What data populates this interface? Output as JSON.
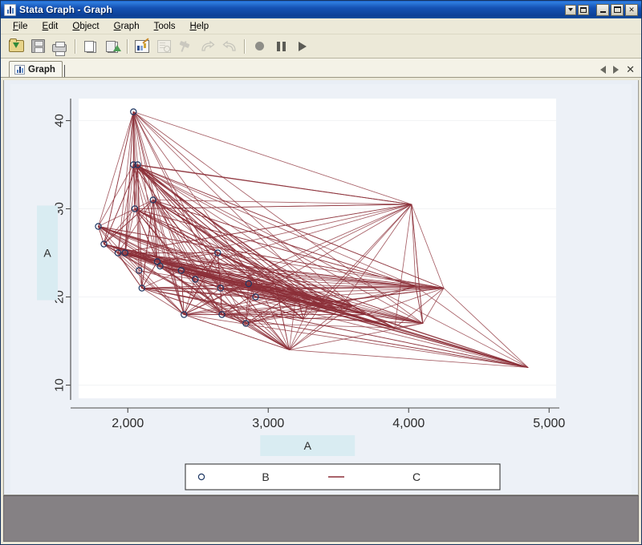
{
  "window": {
    "title": "Stata Graph - Graph",
    "title_icon": "bar-chart-icon",
    "buttons": {
      "mdi_restore_menu": "▾",
      "mdi_restore": "Restore",
      "minimize": "Minimize",
      "maximize": "Maximize",
      "close": "Close"
    }
  },
  "menubar": {
    "items": [
      {
        "label": "File",
        "accel": "F"
      },
      {
        "label": "Edit",
        "accel": "E"
      },
      {
        "label": "Object",
        "accel": "O"
      },
      {
        "label": "Graph",
        "accel": "G"
      },
      {
        "label": "Tools",
        "accel": "T"
      },
      {
        "label": "Help",
        "accel": "H"
      }
    ]
  },
  "toolbar": {
    "items": [
      {
        "name": "open-icon",
        "label": "Open",
        "enabled": true
      },
      {
        "name": "save-icon",
        "label": "Save",
        "enabled": true
      },
      {
        "name": "print-icon",
        "label": "Print",
        "enabled": true
      },
      {
        "name": "copy-icon",
        "label": "Copy",
        "enabled": true
      },
      {
        "name": "paste-icon",
        "label": "Paste",
        "enabled": true
      },
      {
        "name": "graph-editor-icon",
        "label": "Start Graph Editor",
        "enabled": true
      },
      {
        "name": "preview-icon",
        "label": "Preview",
        "enabled": false
      },
      {
        "name": "pin-icon",
        "label": "Pin",
        "enabled": false
      },
      {
        "name": "redo-icon",
        "label": "Redo",
        "enabled": false
      },
      {
        "name": "undo-icon",
        "label": "Undo",
        "enabled": false
      },
      {
        "name": "record-icon",
        "label": "Record",
        "enabled": true
      },
      {
        "name": "pause-icon",
        "label": "Pause",
        "enabled": true
      },
      {
        "name": "play-icon",
        "label": "Play",
        "enabled": true
      }
    ]
  },
  "tabstrip": {
    "tabs": [
      {
        "label": "Graph",
        "icon": "bar-chart-icon",
        "active": true
      }
    ],
    "nav": {
      "prev": "◀",
      "next": "▶",
      "close": "✕"
    }
  },
  "statusbar": {
    "text": ""
  },
  "chart_data": {
    "type": "scatter",
    "title": "",
    "xlabel": "A",
    "ylabel": "A",
    "xlabel_selected": true,
    "ylabel_selected": true,
    "xticks": [
      "2,000",
      "3,000",
      "4,000",
      "5,000"
    ],
    "xtick_values": [
      2000,
      3000,
      4000,
      5000
    ],
    "yticks": [
      "10",
      "20",
      "30",
      "40"
    ],
    "ytick_values": [
      10,
      20,
      30,
      40
    ],
    "xlim": [
      1650,
      5050
    ],
    "ylim": [
      8.5,
      42.5
    ],
    "grid": "horizontal",
    "grid_color": "#f2f3f5",
    "plot_background": "#ffffff",
    "canvas_background": "#edf1f7",
    "legend": {
      "position": "bottom",
      "border": true,
      "entries": [
        {
          "label": "B",
          "marker": "circle-hollow",
          "color": "#1f3864",
          "type": "scatter"
        },
        {
          "label": "C",
          "marker": "line",
          "color": "#8c2f39",
          "type": "line"
        }
      ]
    },
    "series": [
      {
        "name": "B",
        "type": "scatter",
        "marker": "circle-hollow",
        "color": "#1f3864",
        "points": [
          [
            1790,
            28.0
          ],
          [
            1830,
            26.0
          ],
          [
            1930,
            25.0
          ],
          [
            1980,
            25.0
          ],
          [
            2040,
            41.0
          ],
          [
            2040,
            35.0
          ],
          [
            2070,
            35.0
          ],
          [
            2050,
            30.0
          ],
          [
            2080,
            23.0
          ],
          [
            2100,
            21.0
          ],
          [
            2180,
            31.0
          ],
          [
            2210,
            24.0
          ],
          [
            2230,
            23.5
          ],
          [
            2380,
            23.0
          ],
          [
            2400,
            18.0
          ],
          [
            2640,
            25.0
          ],
          [
            2660,
            21.0
          ],
          [
            2670,
            18.0
          ],
          [
            2840,
            17.0
          ],
          [
            2480,
            22.0
          ],
          [
            2860,
            21.5
          ],
          [
            2910,
            20.0
          ]
        ]
      },
      {
        "name": "C",
        "type": "line",
        "color": "#8c2f39",
        "description": "Connected line segments joining observations in data order, producing a dense downward-sloping tangle from the upper-left cluster toward the lower-right tail",
        "path": [
          [
            2040,
            41.0
          ],
          [
            2070,
            35.0
          ],
          [
            2040,
            35.0
          ],
          [
            2050,
            30.0
          ],
          [
            1790,
            28.0
          ],
          [
            2180,
            31.0
          ],
          [
            1830,
            26.0
          ],
          [
            1930,
            25.0
          ],
          [
            1980,
            25.0
          ],
          [
            2210,
            24.0
          ],
          [
            2230,
            23.5
          ],
          [
            2380,
            23.0
          ],
          [
            2100,
            21.0
          ],
          [
            2400,
            18.0
          ],
          [
            2640,
            25.0
          ],
          [
            2660,
            21.0
          ],
          [
            2670,
            18.0
          ],
          [
            2840,
            17.0
          ],
          [
            3200,
            20.5
          ],
          [
            3400,
            19.5
          ],
          [
            4020,
            30.5
          ],
          [
            4250,
            21.0
          ],
          [
            4050,
            21.2
          ],
          [
            3600,
            19.0
          ],
          [
            3300,
            20.0
          ],
          [
            3050,
            21.5
          ],
          [
            2900,
            22.0
          ],
          [
            3500,
            18.5
          ],
          [
            3900,
            16.5
          ],
          [
            4850,
            12.0
          ],
          [
            3150,
            14.0
          ],
          [
            3250,
            17.5
          ],
          [
            3700,
            18.0
          ],
          [
            4100,
            17.0
          ],
          [
            3350,
            19.2
          ],
          [
            2950,
            20.8
          ]
        ]
      }
    ]
  }
}
